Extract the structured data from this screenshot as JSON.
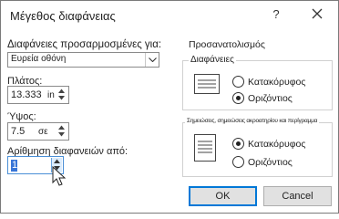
{
  "dialog": {
    "title": "Μέγεθος διαφάνειας",
    "help_label": "?"
  },
  "size": {
    "slides_sized_for_label": "Διαφάνειες προσαρμοσμένες για:",
    "slides_sized_for_value": "Ευρεία οθόνη",
    "width_label": "Πλάτος:",
    "width_value": "13.333",
    "width_unit": "in",
    "height_label": "Ύψος:",
    "height_value": "7.5",
    "height_unit": "σε",
    "numbering_label": "Αρίθμηση διαφανειών από:",
    "numbering_value": "1"
  },
  "orientation": {
    "group_label": "Προσανατολισμός",
    "slides": {
      "label": "Διαφάνειες",
      "options": [
        "Κατακόρυφος",
        "Οριζόντιος"
      ],
      "selected": "Οριζόντιος"
    },
    "notes": {
      "label": "Σημειώσεις, σημειώσεις ακροατηρίου και περίγραμμα",
      "options": [
        "Κατακόρυφος",
        "Οριζόντιος"
      ],
      "selected": "Κατακόρυφος"
    }
  },
  "buttons": {
    "ok": "OK",
    "cancel": "Cancel"
  },
  "colors": {
    "accent": "#0078d7",
    "selection": "#3875d7"
  }
}
